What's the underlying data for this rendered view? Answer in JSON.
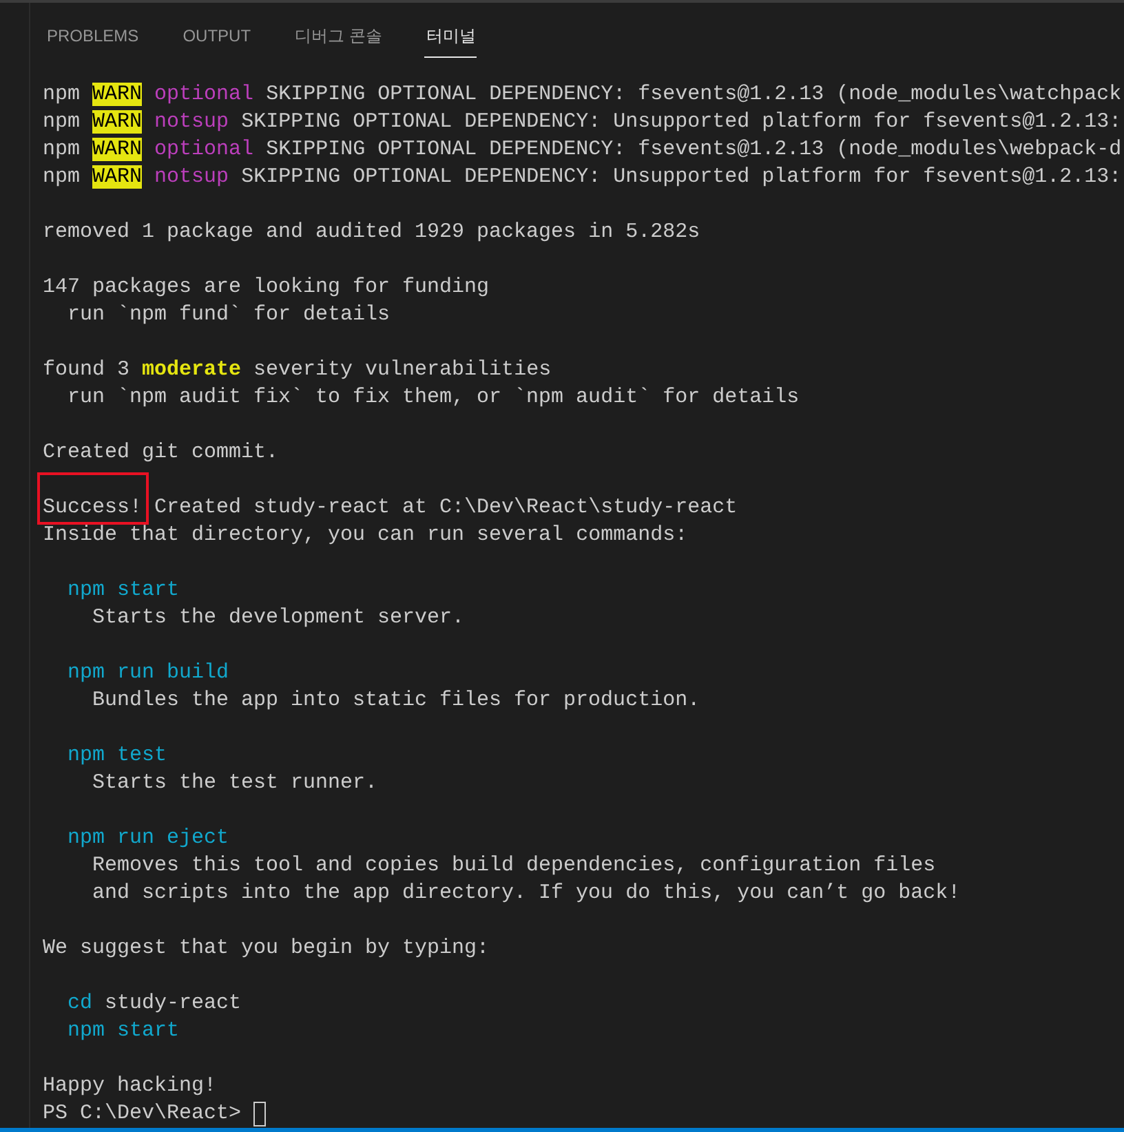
{
  "tabs": [
    {
      "label": "PROBLEMS",
      "selected": false
    },
    {
      "label": "OUTPUT",
      "selected": false
    },
    {
      "label": "디버그 콘솔",
      "selected": false
    },
    {
      "label": "터미널",
      "selected": true
    }
  ],
  "terminal": {
    "lines": [
      {
        "kind": "warn",
        "program": "npm",
        "level": "WARN",
        "tag": "optional",
        "message": "SKIPPING OPTIONAL DEPENDENCY: fsevents@1.2.13 (node_modules\\watchpack"
      },
      {
        "kind": "warn",
        "program": "npm",
        "level": "WARN",
        "tag": "notsup",
        "message": "SKIPPING OPTIONAL DEPENDENCY: Unsupported platform for fsevents@1.2.13:"
      },
      {
        "kind": "warn",
        "program": "npm",
        "level": "WARN",
        "tag": "optional",
        "message": "SKIPPING OPTIONAL DEPENDENCY: fsevents@1.2.13 (node_modules\\webpack-d"
      },
      {
        "kind": "warn",
        "program": "npm",
        "level": "WARN",
        "tag": "notsup",
        "message": "SKIPPING OPTIONAL DEPENDENCY: Unsupported platform for fsevents@1.2.13:"
      },
      {
        "kind": "blank"
      },
      {
        "kind": "text",
        "text": "removed 1 package and audited 1929 packages in 5.282s"
      },
      {
        "kind": "blank"
      },
      {
        "kind": "text",
        "text": "147 packages are looking for funding"
      },
      {
        "kind": "hint",
        "text": "run `npm fund` for details"
      },
      {
        "kind": "blank"
      },
      {
        "kind": "text",
        "text": "found 3 **moderate** severity vulnerabilities"
      },
      {
        "kind": "hint",
        "text": "run `npm audit fix` to fix them, or `npm audit` for details"
      },
      {
        "kind": "blank"
      },
      {
        "kind": "text",
        "text": "Created git commit."
      },
      {
        "kind": "blank"
      },
      {
        "kind": "success",
        "label": "Success!",
        "boxed": true,
        "text": "Created study-react at C:\\Dev\\React\\study-react"
      },
      {
        "kind": "text",
        "text": "Inside that directory, you can run several commands:"
      },
      {
        "kind": "blank"
      },
      {
        "kind": "command",
        "command": "npm start"
      },
      {
        "kind": "detail",
        "text": "Starts the development server."
      },
      {
        "kind": "blank"
      },
      {
        "kind": "command",
        "command": "npm run build"
      },
      {
        "kind": "detail",
        "text": "Bundles the app into static files for production."
      },
      {
        "kind": "blank"
      },
      {
        "kind": "command",
        "command": "npm test"
      },
      {
        "kind": "detail",
        "text": "Starts the test runner."
      },
      {
        "kind": "blank"
      },
      {
        "kind": "command",
        "command": "npm run eject"
      },
      {
        "kind": "detail",
        "text": "Removes this tool and copies build dependencies, configuration files"
      },
      {
        "kind": "detail",
        "text": "and scripts into the app directory. If you do this, you can’t go back!"
      },
      {
        "kind": "blank"
      },
      {
        "kind": "text",
        "text": "We suggest that you begin by typing:"
      },
      {
        "kind": "blank"
      },
      {
        "kind": "command",
        "command": "cd",
        "argument": "study-react"
      },
      {
        "kind": "command",
        "command": "npm start"
      },
      {
        "kind": "blank"
      },
      {
        "kind": "text",
        "text": "Happy hacking!"
      },
      {
        "kind": "prompt",
        "text": "PS C:\\Dev\\React>"
      }
    ]
  }
}
